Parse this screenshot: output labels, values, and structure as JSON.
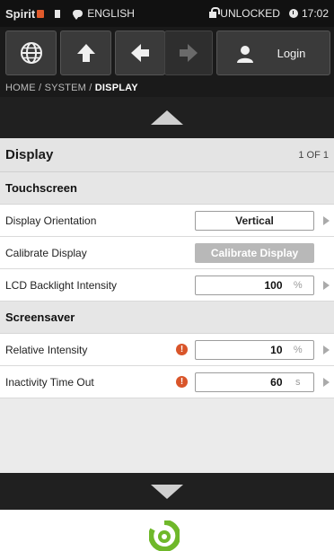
{
  "status_bar": {
    "brand": "Spirit",
    "language": "ENGLISH",
    "lock_status": "UNLOCKED",
    "time": "17:02"
  },
  "toolbar": {
    "login_label": "Login",
    "icons": [
      "globe-icon",
      "up-arrow-icon",
      "back-arrow-icon",
      "forward-arrow-icon",
      "user-icon"
    ]
  },
  "breadcrumb": {
    "path": "HOME / SYSTEM / ",
    "current": "DISPLAY"
  },
  "panel": {
    "title": "Display",
    "page_count": "1 OF 1"
  },
  "sections": {
    "touchscreen": {
      "title": "Touchscreen",
      "display_orientation": {
        "label": "Display Orientation",
        "value": "Vertical"
      },
      "calibrate": {
        "label": "Calibrate Display",
        "button": "Calibrate Display"
      },
      "backlight": {
        "label": "LCD Backlight Intensity",
        "value": "100",
        "unit": "%"
      }
    },
    "screensaver": {
      "title": "Screensaver",
      "relative_intensity": {
        "label": "Relative Intensity",
        "value": "10",
        "unit": "%"
      },
      "inactivity": {
        "label": "Inactivity Time Out",
        "value": "60",
        "unit": "s"
      }
    }
  },
  "colors": {
    "accent": "#6fb82a",
    "warning": "#d9552a",
    "brand_mark": "#e05a2b"
  }
}
